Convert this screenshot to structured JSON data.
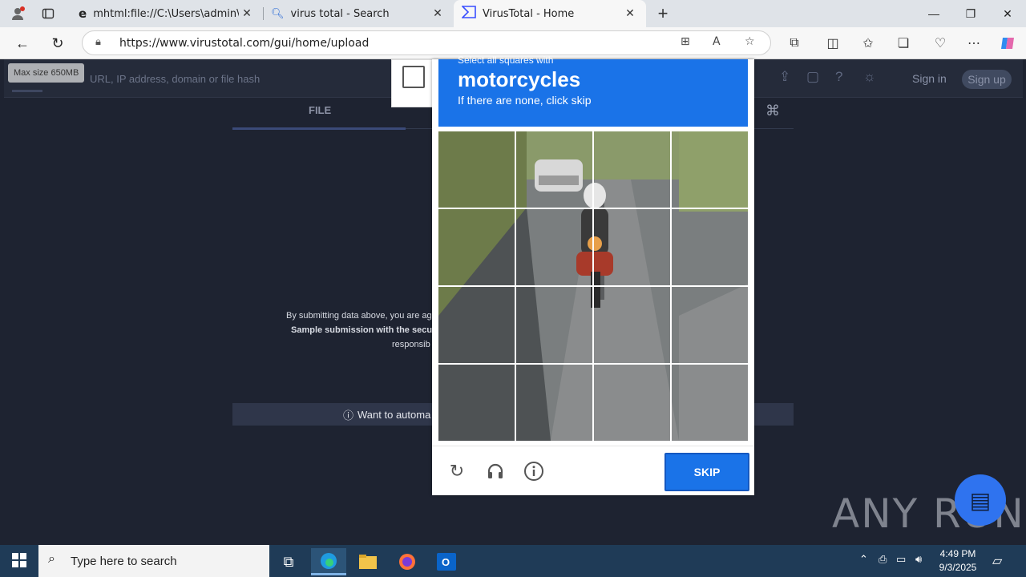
{
  "browser": {
    "tabs": [
      {
        "title": "mhtml:file://C:\\Users\\admin\\AppD",
        "icon": "ie-icon"
      },
      {
        "title": "virus total - Search",
        "icon": "search-icon"
      },
      {
        "title": "VirusTotal - Home",
        "icon": "virustotal-icon"
      }
    ],
    "url": "https://www.virustotal.com/gui/home/upload"
  },
  "vt": {
    "search_placeholder": "URL, IP address, domain or file hash",
    "tooltip": "Max size 650MB",
    "sign_in": "Sign in",
    "sign_up": "Sign up",
    "tab_file": "FILE",
    "terms_line1": "By submitting data above, you are ag",
    "terms_line2": "Sample submission with the secu",
    "terms_line3": "responsib",
    "automate": "Want to automa"
  },
  "captcha": {
    "instruction": "Select all squares with",
    "target": "motorcycles",
    "hint": "If there are none, click skip",
    "skip_label": "SKIP"
  },
  "watermark": "ANY RUN",
  "taskbar": {
    "search_placeholder": "Type here to search",
    "time": "4:49 PM",
    "date": "9/3/2025"
  }
}
